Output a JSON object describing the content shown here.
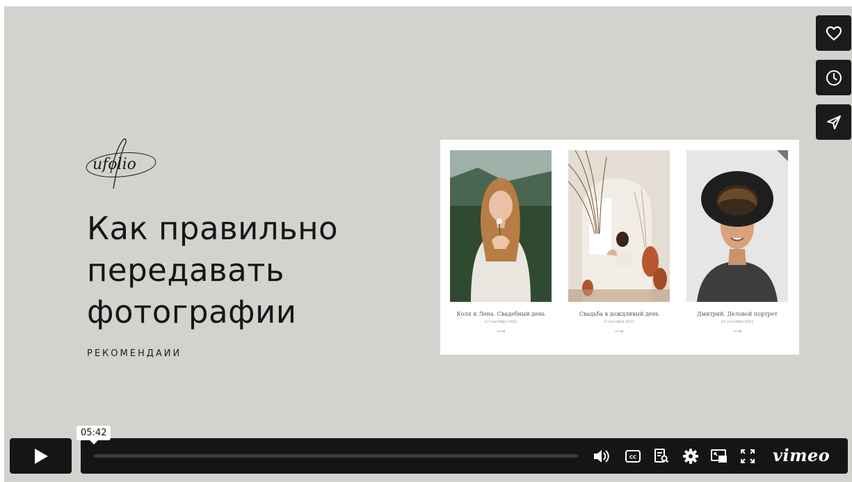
{
  "slide": {
    "logo_text": "ufolio",
    "title_lines": [
      "Как правильно",
      "передавать",
      "фотографии"
    ],
    "subtitle": "РЕКОМЕНДАИИ"
  },
  "preview": {
    "cards": [
      {
        "caption": "Коля и Лена. Свадебный день",
        "date": "12 сентября 2021",
        "arrow": "⟶"
      },
      {
        "caption": "Свадьба в дождливый день",
        "date": "2 сентября 2021",
        "arrow": "⟶"
      },
      {
        "caption": "Дмитрий. Деловой портрет",
        "date": "23 сентября 2021",
        "arrow": "⟶"
      }
    ]
  },
  "side_buttons": {
    "like": "heart-icon",
    "watch_later": "clock-icon",
    "share": "send-icon"
  },
  "player": {
    "time_tooltip": "05:42",
    "progress_fraction": 0,
    "brand": "vimeo"
  },
  "colors": {
    "background": "#d3d2ce",
    "control_bg": "#151515",
    "track": "#3b3b3b",
    "icon": "#ffffff"
  }
}
